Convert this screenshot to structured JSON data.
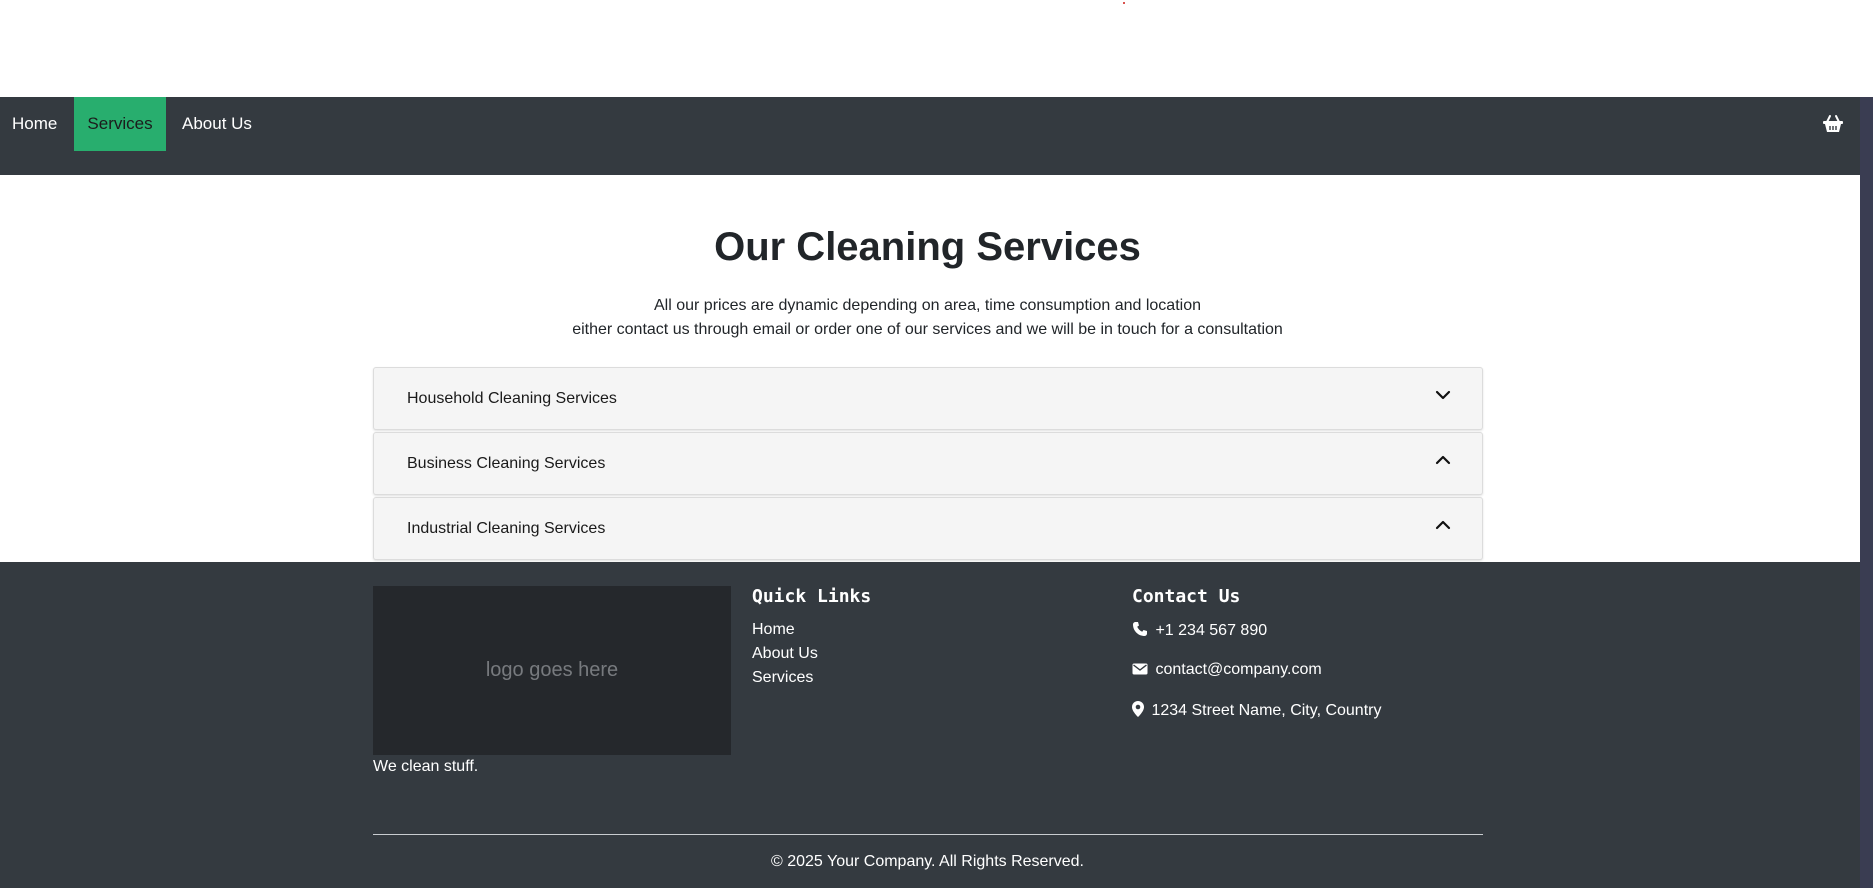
{
  "nav": {
    "items": [
      {
        "label": "Home",
        "active": false
      },
      {
        "label": "Services",
        "active": true
      },
      {
        "label": "About Us",
        "active": false
      }
    ],
    "cart_icon": "basket-icon",
    "active_color": "#28ae6e",
    "background": "#343a40"
  },
  "main": {
    "title": "Our Cleaning Services",
    "subtitle_line1": "All our prices are dynamic depending on area, time consumption and location",
    "subtitle_line2": "either contact us through email or order one of our services and we will be in touch for a consultation",
    "accordion": [
      {
        "label": "Household Cleaning Services",
        "chevron": "chevron-down-icon"
      },
      {
        "label": "Business Cleaning Services",
        "chevron": "chevron-up-icon"
      },
      {
        "label": "Industrial Cleaning Services",
        "chevron": "chevron-up-icon"
      }
    ]
  },
  "footer": {
    "logo_placeholder": "logo goes here",
    "tagline": "We clean stuff.",
    "quick_links_heading": "Quick Links",
    "quick_links": [
      "Home",
      "About Us",
      "Services"
    ],
    "contact_heading": "Contact Us",
    "contact": {
      "phone": "+1 234 567 890",
      "email": "contact@company.com",
      "address": "1234 Street Name, City, Country"
    },
    "copyright": "© 2025 Your Company. All Rights Reserved."
  }
}
